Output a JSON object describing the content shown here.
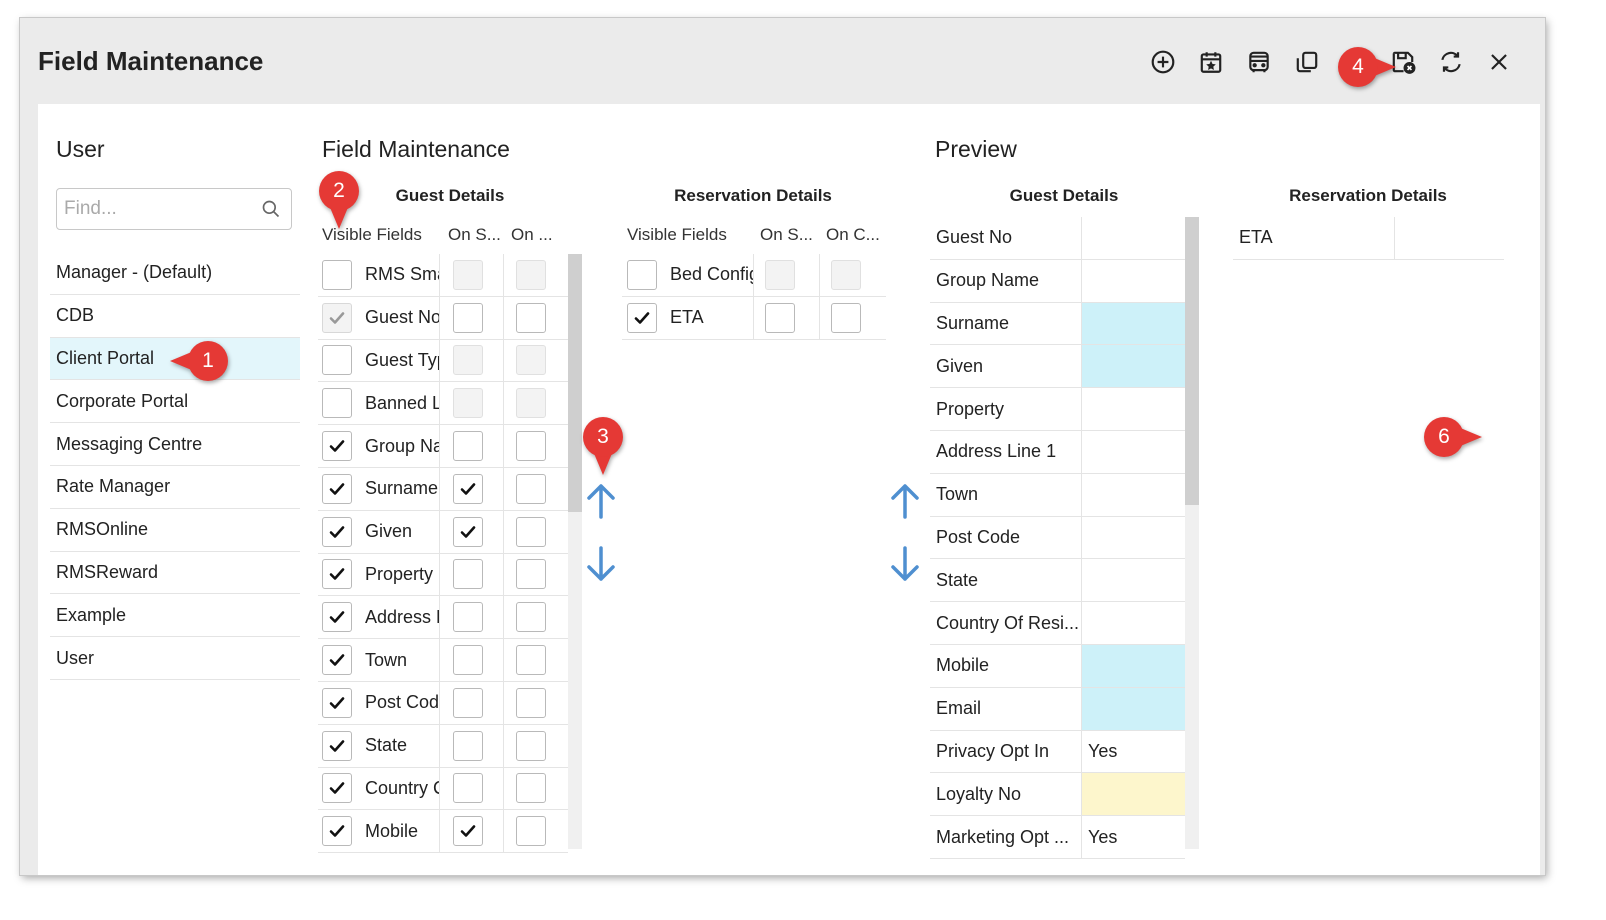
{
  "window": {
    "title": "Field Maintenance"
  },
  "toolbar": [
    {
      "name": "add-icon"
    },
    {
      "name": "calendar-icon"
    },
    {
      "name": "bus-icon"
    },
    {
      "name": "copy-icon"
    },
    {
      "name": "history-icon"
    },
    {
      "name": "save-close-icon"
    },
    {
      "name": "refresh-icon"
    },
    {
      "name": "close-icon"
    }
  ],
  "user_panel": {
    "heading": "User",
    "search_placeholder": "Find...",
    "items": [
      "Manager - (Default)",
      "CDB",
      "Client Portal",
      "Corporate Portal",
      "Messaging Centre",
      "Rate Manager",
      "RMSOnline",
      "RMSReward",
      "Example",
      "User"
    ],
    "selected": "Client Portal"
  },
  "field_maintenance": {
    "heading": "Field Maintenance",
    "guest_details": {
      "title": "Guest Details",
      "columns": [
        "Visible Fields",
        "On S...",
        "On ..."
      ],
      "rows": [
        {
          "label": "RMS Sma",
          "visible": false,
          "on_s": null,
          "on_c": null
        },
        {
          "label": "Guest No",
          "visible": "locked",
          "on_s": false,
          "on_c": false
        },
        {
          "label": "Guest Typ",
          "visible": false,
          "on_s": null,
          "on_c": null
        },
        {
          "label": "Banned L",
          "visible": false,
          "on_s": null,
          "on_c": null
        },
        {
          "label": "Group Na",
          "visible": true,
          "on_s": false,
          "on_c": false
        },
        {
          "label": "Surname",
          "visible": true,
          "on_s": true,
          "on_c": false
        },
        {
          "label": "Given",
          "visible": true,
          "on_s": true,
          "on_c": false
        },
        {
          "label": "Property",
          "visible": true,
          "on_s": false,
          "on_c": false
        },
        {
          "label": "Address L",
          "visible": true,
          "on_s": false,
          "on_c": false
        },
        {
          "label": "Town",
          "visible": true,
          "on_s": false,
          "on_c": false
        },
        {
          "label": "Post Code",
          "visible": true,
          "on_s": false,
          "on_c": false
        },
        {
          "label": "State",
          "visible": true,
          "on_s": false,
          "on_c": false
        },
        {
          "label": "Country C",
          "visible": true,
          "on_s": false,
          "on_c": false
        },
        {
          "label": "Mobile",
          "visible": true,
          "on_s": true,
          "on_c": false
        }
      ]
    },
    "reservation_details": {
      "title": "Reservation Details",
      "columns": [
        "Visible Fields",
        "On S...",
        "On C..."
      ],
      "rows": [
        {
          "label": "Bed Config",
          "visible": false,
          "on_s": null,
          "on_c": null
        },
        {
          "label": "ETA",
          "visible": true,
          "on_s": false,
          "on_c": false
        }
      ]
    }
  },
  "preview": {
    "heading": "Preview",
    "guest_details": {
      "title": "Guest Details",
      "rows": [
        {
          "label": "Guest No",
          "value": "",
          "highlight": ""
        },
        {
          "label": "Group Name",
          "value": "",
          "highlight": ""
        },
        {
          "label": "Surname",
          "value": "",
          "highlight": "#cdf1f9"
        },
        {
          "label": "Given",
          "value": "",
          "highlight": "#cdf1f9"
        },
        {
          "label": "Property",
          "value": "",
          "highlight": ""
        },
        {
          "label": "Address Line 1",
          "value": "",
          "highlight": ""
        },
        {
          "label": "Town",
          "value": "",
          "highlight": ""
        },
        {
          "label": "Post Code",
          "value": "",
          "highlight": ""
        },
        {
          "label": "State",
          "value": "",
          "highlight": ""
        },
        {
          "label": "Country Of Resi...",
          "value": "",
          "highlight": ""
        },
        {
          "label": "Mobile",
          "value": "",
          "highlight": "#cdf1f9"
        },
        {
          "label": "Email",
          "value": "",
          "highlight": "#cdf1f9"
        },
        {
          "label": "Privacy Opt In",
          "value": "Yes",
          "highlight": ""
        },
        {
          "label": "Loyalty No",
          "value": "",
          "highlight": "#fdf6cc"
        },
        {
          "label": "Marketing Opt ...",
          "value": "Yes",
          "highlight": ""
        }
      ]
    },
    "reservation_details": {
      "title": "Reservation Details",
      "rows": [
        {
          "label": "ETA",
          "value": ""
        }
      ]
    }
  },
  "callouts": [
    "1",
    "2",
    "3",
    "4",
    "6"
  ],
  "colors": {
    "callout": "#e53935",
    "arrow": "#4f8fd0",
    "selected_row": "#e3f6fb"
  }
}
